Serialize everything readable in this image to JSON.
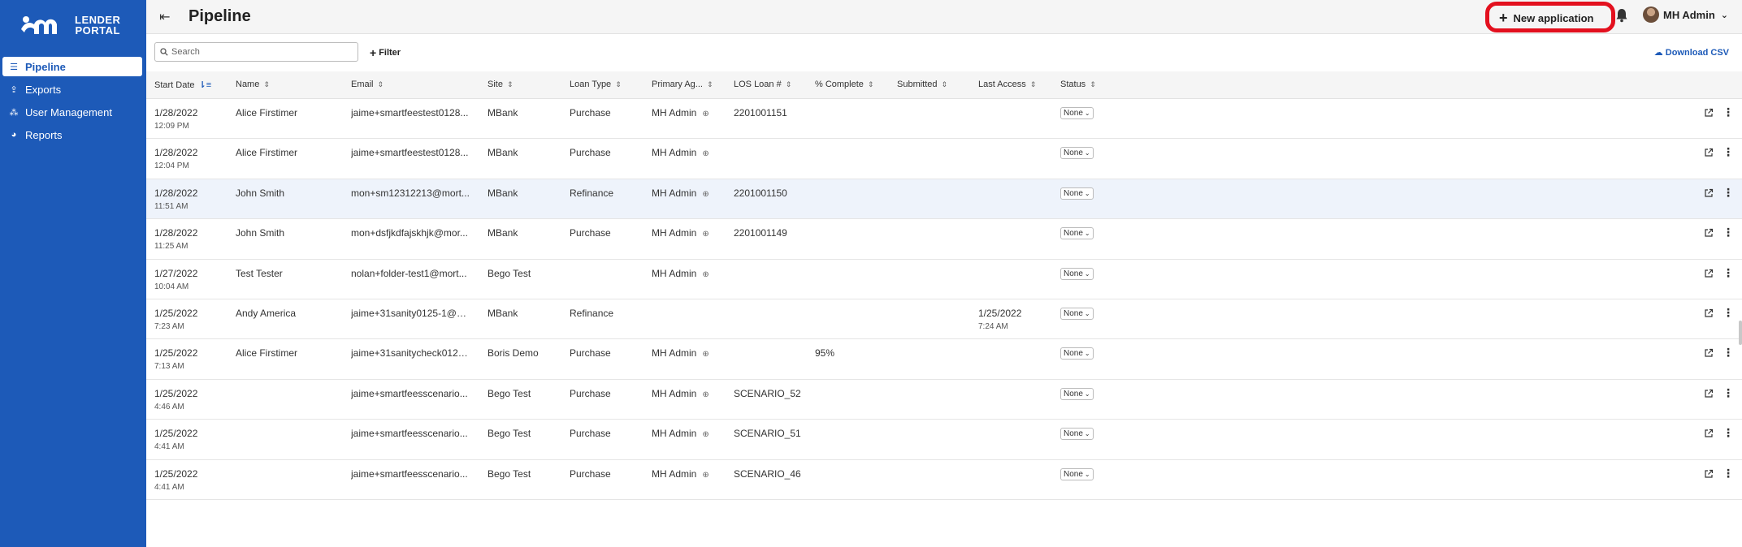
{
  "brand": {
    "line1": "LENDER",
    "line2": "PORTAL"
  },
  "sidebar": {
    "items": [
      {
        "label": "Pipeline",
        "icon": "sliders-icon",
        "active": true
      },
      {
        "label": "Exports",
        "icon": "export-icon",
        "active": false
      },
      {
        "label": "User Management",
        "icon": "users-icon",
        "active": false
      },
      {
        "label": "Reports",
        "icon": "pie-chart-icon",
        "active": false
      }
    ]
  },
  "header": {
    "title": "Pipeline",
    "new_application_label": "New application",
    "user_name": "MH Admin"
  },
  "toolbar": {
    "search_placeholder": "Search",
    "filter_label": "Filter",
    "download_label": "Download CSV"
  },
  "table": {
    "columns": [
      "Start Date",
      "Name",
      "Email",
      "Site",
      "Loan Type",
      "Primary Ag...",
      "LOS Loan #",
      "% Complete",
      "Submitted",
      "Last Access",
      "Status"
    ],
    "rows": [
      {
        "date": "1/28/2022",
        "time": "12:09 PM",
        "name": "Alice Firstimer",
        "email": "jaime+smartfeestest0128...",
        "site": "MBank",
        "loan_type": "Purchase",
        "agent": "MH Admin",
        "los": "2201001151",
        "complete": "",
        "submitted": "",
        "last_access": "",
        "last_access_time": "",
        "status": "None"
      },
      {
        "date": "1/28/2022",
        "time": "12:04 PM",
        "name": "Alice Firstimer",
        "email": "jaime+smartfeestest0128...",
        "site": "MBank",
        "loan_type": "Purchase",
        "agent": "MH Admin",
        "los": "",
        "complete": "",
        "submitted": "",
        "last_access": "",
        "last_access_time": "",
        "status": "None"
      },
      {
        "date": "1/28/2022",
        "time": "11:51 AM",
        "name": "John Smith",
        "email": "mon+sm12312213@mort...",
        "site": "MBank",
        "loan_type": "Refinance",
        "agent": "MH Admin",
        "los": "2201001150",
        "complete": "",
        "submitted": "",
        "last_access": "",
        "last_access_time": "",
        "status": "None"
      },
      {
        "date": "1/28/2022",
        "time": "11:25 AM",
        "name": "John Smith",
        "email": "mon+dsfjkdfajskhjk@mor...",
        "site": "MBank",
        "loan_type": "Purchase",
        "agent": "MH Admin",
        "los": "2201001149",
        "complete": "",
        "submitted": "",
        "last_access": "",
        "last_access_time": "",
        "status": "None"
      },
      {
        "date": "1/27/2022",
        "time": "10:04 AM",
        "name": "Test Tester",
        "email": "nolan+folder-test1@mort...",
        "site": "Bego Test",
        "loan_type": "",
        "agent": "MH Admin",
        "los": "",
        "complete": "",
        "submitted": "",
        "last_access": "",
        "last_access_time": "",
        "status": "None"
      },
      {
        "date": "1/25/2022",
        "time": "7:23 AM",
        "name": "Andy America",
        "email": "jaime+31sanity0125-1@m...",
        "site": "MBank",
        "loan_type": "Refinance",
        "agent": "",
        "los": "",
        "complete": "",
        "submitted": "",
        "last_access": "1/25/2022",
        "last_access_time": "7:24 AM",
        "status": "None"
      },
      {
        "date": "1/25/2022",
        "time": "7:13 AM",
        "name": "Alice Firstimer",
        "email": "jaime+31sanitycheck0125...",
        "site": "Boris Demo",
        "loan_type": "Purchase",
        "agent": "MH Admin",
        "los": "",
        "complete": "95%",
        "submitted": "",
        "last_access": "",
        "last_access_time": "",
        "status": "None"
      },
      {
        "date": "1/25/2022",
        "time": "4:46 AM",
        "name": "",
        "email": "jaime+smartfeesscenario...",
        "site": "Bego Test",
        "loan_type": "Purchase",
        "agent": "MH Admin",
        "los": "SCENARIO_52",
        "complete": "",
        "submitted": "",
        "last_access": "",
        "last_access_time": "",
        "status": "None"
      },
      {
        "date": "1/25/2022",
        "time": "4:41 AM",
        "name": "",
        "email": "jaime+smartfeesscenario...",
        "site": "Bego Test",
        "loan_type": "Purchase",
        "agent": "MH Admin",
        "los": "SCENARIO_51",
        "complete": "",
        "submitted": "",
        "last_access": "",
        "last_access_time": "",
        "status": "None"
      },
      {
        "date": "1/25/2022",
        "time": "4:41 AM",
        "name": "",
        "email": "jaime+smartfeesscenario...",
        "site": "Bego Test",
        "loan_type": "Purchase",
        "agent": "MH Admin",
        "los": "SCENARIO_46",
        "complete": "",
        "submitted": "",
        "last_access": "",
        "last_access_time": "",
        "status": "None"
      }
    ]
  },
  "colors": {
    "brand_blue": "#1d5ab8",
    "highlight_red": "#e3101e"
  }
}
